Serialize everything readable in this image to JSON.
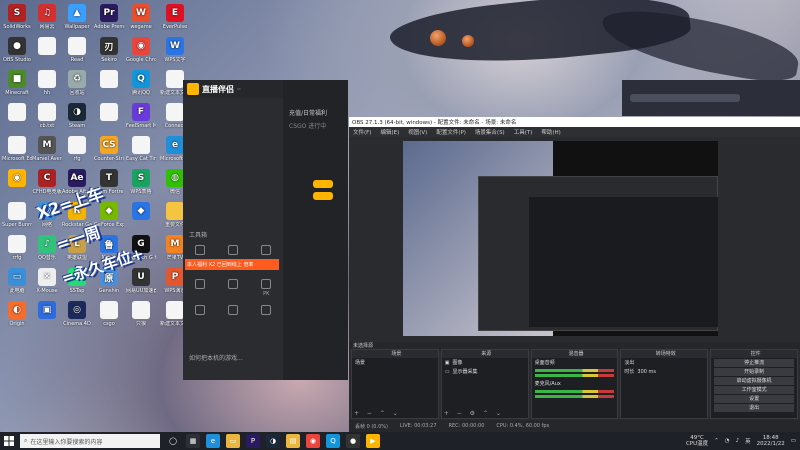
{
  "desktop_icons": [
    {
      "label": "SolidWorks",
      "color": "#b22222",
      "glyph": "S"
    },
    {
      "label": "OBS Studio",
      "color": "#333333",
      "glyph": "●"
    },
    {
      "label": "Minecraft",
      "color": "#4c8a2c",
      "glyph": "■"
    },
    {
      "label": "",
      "color": "#f5f5f5",
      "glyph": ""
    },
    {
      "label": "Microsoft Edge",
      "color": "#f5f5f5",
      "glyph": ""
    },
    {
      "label": "",
      "color": "#ffb400",
      "glyph": "◉"
    },
    {
      "label": "Super Bunny Man",
      "color": "#f5f5f5",
      "glyph": ""
    },
    {
      "label": "rrfg",
      "color": "#f5f5f5",
      "glyph": ""
    },
    {
      "label": "此电脑",
      "color": "#3b8fd8",
      "glyph": "▭"
    },
    {
      "label": "Origin",
      "color": "#f56c2d",
      "glyph": "◐"
    },
    {
      "label": "网易云",
      "color": "#d32f2f",
      "glyph": "♫"
    },
    {
      "label": "",
      "color": "#f5f5f5",
      "glyph": ""
    },
    {
      "label": "hh",
      "color": "#f5f5f5",
      "glyph": ""
    },
    {
      "label": "cb.txt",
      "color": "#f5f5f5",
      "glyph": ""
    },
    {
      "label": "Marvel Avenger",
      "color": "#555555",
      "glyph": "M"
    },
    {
      "label": "CFHD电竞版",
      "color": "#a22",
      "glyph": "C"
    },
    {
      "label": "网络",
      "color": "#3b8fd8",
      "glyph": "◎"
    },
    {
      "label": "QQ音乐",
      "color": "#31c27c",
      "glyph": "♪"
    },
    {
      "label": "X-Mouse",
      "color": "#eeeeee",
      "glyph": "✕"
    },
    {
      "label": "",
      "color": "#2d6cdf",
      "glyph": "▣"
    },
    {
      "label": "Wallpaper",
      "color": "#3aa0ff",
      "glyph": "▲"
    },
    {
      "label": "Read",
      "color": "#f5f5f5",
      "glyph": ""
    },
    {
      "label": "回收站",
      "color": "#9aa",
      "glyph": "♻"
    },
    {
      "label": "Steam",
      "color": "#1b2838",
      "glyph": "◑"
    },
    {
      "label": "rfg",
      "color": "#f5f5f5",
      "glyph": ""
    },
    {
      "label": "Adobe After 2020",
      "color": "#2a1a5e",
      "glyph": "Ae"
    },
    {
      "label": "Rockstar Games",
      "color": "#f5b400",
      "glyph": "R"
    },
    {
      "label": "英雄联盟",
      "color": "#c9a04a",
      "glyph": "L"
    },
    {
      "label": "SSTap",
      "color": "#2d7",
      "glyph": "S"
    },
    {
      "label": "Cinema 4D",
      "color": "#1b2a5a",
      "glyph": "◎"
    },
    {
      "label": "Adobe Premiere",
      "color": "#2a1a5e",
      "glyph": "Pr"
    },
    {
      "label": "Sekiro",
      "color": "#333",
      "glyph": "刃"
    },
    {
      "label": "",
      "color": "#f5f5f5",
      "glyph": ""
    },
    {
      "label": "",
      "color": "#f5f5f5",
      "glyph": ""
    },
    {
      "label": "Counter-Strike Global",
      "color": "#f5a623",
      "glyph": "CS"
    },
    {
      "label": "Team Fortress",
      "color": "#333",
      "glyph": "T"
    },
    {
      "label": "GeForce Experience",
      "color": "#76b900",
      "glyph": "◆"
    },
    {
      "label": "鲁大师",
      "color": "#2b74e3",
      "glyph": "鲁"
    },
    {
      "label": "Genshin",
      "color": "#4a8fdb",
      "glyph": "原"
    },
    {
      "label": "csgo",
      "color": "#f5f5f5",
      "glyph": ""
    },
    {
      "label": "wegame",
      "color": "#e94e2e",
      "glyph": "W"
    },
    {
      "label": "Google Chrome",
      "color": "#e8453c",
      "glyph": "◉"
    },
    {
      "label": "腾讯QQ",
      "color": "#1296db",
      "glyph": "Q"
    },
    {
      "label": "FeelSmart Motion",
      "color": "#6a3bd9",
      "glyph": "F"
    },
    {
      "label": "Easy Cat Timer",
      "color": "#f5f5f5",
      "glyph": ""
    },
    {
      "label": "WPS表格",
      "color": "#1aa260",
      "glyph": "S"
    },
    {
      "label": "",
      "color": "#2b74e3",
      "glyph": "◆"
    },
    {
      "label": "Logitech G HUB",
      "color": "#111",
      "glyph": "G"
    },
    {
      "label": "网易UU加速器",
      "color": "#333",
      "glyph": "U"
    },
    {
      "label": "只狼",
      "color": "#f5f5f5",
      "glyph": ""
    },
    {
      "label": "EverPulse",
      "color": "#d12",
      "glyph": "E"
    },
    {
      "label": "WPS文字",
      "color": "#2b74e3",
      "glyph": "W"
    },
    {
      "label": "新建文本文档",
      "color": "#f5f5f5",
      "glyph": ""
    },
    {
      "label": "Connect",
      "color": "#f5f5f5",
      "glyph": ""
    },
    {
      "label": "Microsoft Edge",
      "color": "#1e8fd8",
      "glyph": "e"
    },
    {
      "label": "微信",
      "color": "#2dc100",
      "glyph": "◍"
    },
    {
      "label": "重要文件",
      "color": "#f5c542",
      "glyph": ""
    },
    {
      "label": "芒果TV",
      "color": "#f58220",
      "glyph": "M"
    },
    {
      "label": "WPS演示",
      "color": "#e4572e",
      "glyph": "P"
    },
    {
      "label": "新建文本文档",
      "color": "#f5f5f5",
      "glyph": ""
    },
    {
      "label": "Steam-镜上\n&.exe",
      "color": "#f5f5f5",
      "glyph": ""
    }
  ],
  "overlay": {
    "line1": "X2=上车",
    "line2": "=一周",
    "line3": "=永久车位+"
  },
  "live_app": {
    "brand": "直播伴侣",
    "version": "",
    "promo": "本人福利 X2 已回到线上 倍率",
    "tools_title": "工具箱",
    "tools": [
      "",
      "",
      "",
      "PK",
      "",
      "",
      "",
      "",
      ""
    ],
    "bottom_text": "如何把本机的游戏..."
  },
  "live_right": {
    "header": "充值/日常福利",
    "button": "推荐",
    "label": "CSGO 进行中"
  },
  "obs": {
    "title": "OBS 27.1.3 (64-bit, windows) - 配置文件: 未命名 - 场景: 未命名",
    "menu": [
      "文件(F)",
      "编辑(E)",
      "视图(V)",
      "配置文件(P)",
      "场景集合(S)",
      "工具(T)",
      "帮助(H)"
    ],
    "scene_bar": "未选择源",
    "panels": {
      "scenes": {
        "title": "场景",
        "items": [
          "场景"
        ]
      },
      "sources": {
        "title": "来源",
        "items": [
          "图像",
          "显示器采集"
        ]
      },
      "mixer": {
        "title": "混音器",
        "tracks": [
          "桌面音频",
          "麦克风/Aux"
        ]
      },
      "transitions": {
        "title": "转场特效",
        "type": "淡出",
        "duration_label": "时长",
        "duration": "300 ms"
      },
      "controls": {
        "title": "控件",
        "buttons": [
          "停止推流",
          "开始录制",
          "启动虚拟摄像机",
          "工作室模式",
          "设置",
          "退出"
        ]
      }
    },
    "status": {
      "dropped": "丢帧 0 (0.0%)",
      "live": "LIVE: 00:03:27",
      "rec": "REC: 00:00:00",
      "cpu": "CPU: 0.4%, 60.00 fps"
    }
  },
  "taskbar": {
    "search_placeholder": "在这里输入你要搜索的内容",
    "weather": "49°C",
    "weather_sub": "CPU温度",
    "time": "18:48",
    "date": "2022/1/22",
    "lang": "英"
  }
}
